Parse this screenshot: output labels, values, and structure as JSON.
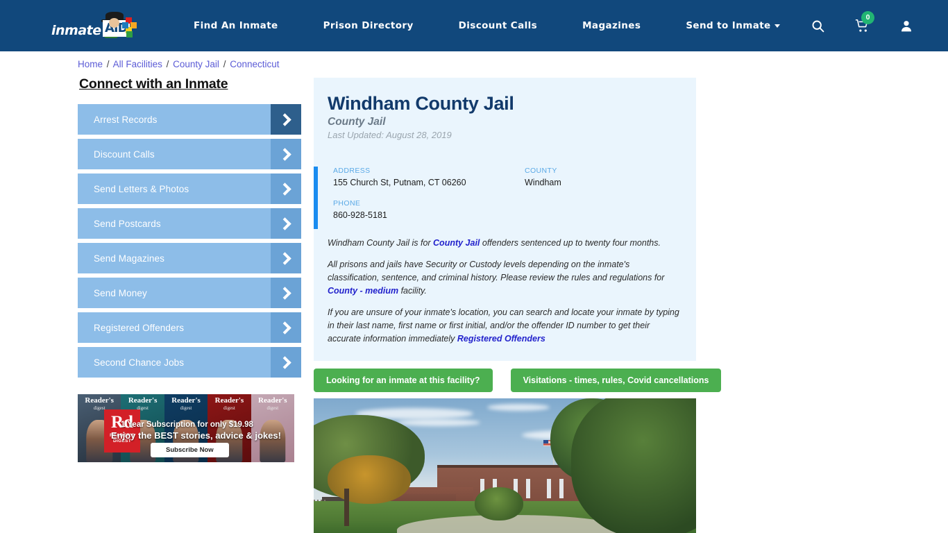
{
  "header": {
    "logo": {
      "word": "inmate",
      "aid": "AID",
      "alt": "inmateaid-logo"
    },
    "nav": [
      {
        "label": "Find An Inmate",
        "dropdown": false
      },
      {
        "label": "Prison Directory",
        "dropdown": false
      },
      {
        "label": "Discount Calls",
        "dropdown": false
      },
      {
        "label": "Magazines",
        "dropdown": false
      },
      {
        "label": "Send to Inmate",
        "dropdown": true
      }
    ],
    "icons": {
      "search": "search-icon",
      "cart": "shopping-cart-icon",
      "cart_count": "0",
      "account": "user-account-icon"
    },
    "colors": {
      "bar": "#11487c",
      "badge": "#22b573"
    }
  },
  "breadcrumb": {
    "items": [
      "Home",
      "All Facilities",
      "County Jail",
      "Connecticut"
    ],
    "separator": "/"
  },
  "sidebar": {
    "title": "Connect with an Inmate",
    "items": [
      {
        "label": "Arrest Records",
        "active": true
      },
      {
        "label": "Discount Calls",
        "active": false
      },
      {
        "label": "Send Letters & Photos",
        "active": false
      },
      {
        "label": "Send Postcards",
        "active": false
      },
      {
        "label": "Send Magazines",
        "active": false
      },
      {
        "label": "Send Money",
        "active": false
      },
      {
        "label": "Registered Offenders",
        "active": false
      },
      {
        "label": "Second Chance Jobs",
        "active": false
      }
    ]
  },
  "ad": {
    "brand": "Reader's",
    "brand2": "digest",
    "rd_mark": "Rd",
    "rd_label1": "READER'S",
    "rd_label2": "DIGEST",
    "line1": "1 Year Subscription for only $19.98",
    "line2": "Enjoy the BEST stories, advice & jokes!",
    "cta": "Subscribe Now"
  },
  "facility": {
    "title": "Windham County Jail",
    "subtitle": "County Jail",
    "last_updated": "Last Updated: August 28, 2019",
    "fields": {
      "address_label": "ADDRESS",
      "address_value": "155 Church St, Putnam, CT 06260",
      "phone_label": "PHONE",
      "phone_value": "860-928-5181",
      "county_label": "COUNTY",
      "county_value": "Windham"
    },
    "paragraphs": {
      "p1_a": "Windham County Jail is for ",
      "p1_link": "County Jail",
      "p1_b": " offenders sentenced up to twenty four months.",
      "p2_a": "All prisons and jails have Security or Custody levels depending on the inmate's classification, sentence, and criminal history. Please review the rules and regulations for ",
      "p2_link": "County - medium",
      "p2_b": " facility.",
      "p3_a": "If you are unsure of your inmate's location, you can search and locate your inmate by typing in their last name, first name or first initial, and/or the offender ID number to get their accurate information immediately ",
      "p3_link": "Registered Offenders"
    },
    "buttons": [
      {
        "label": "Looking for an inmate at this facility?"
      },
      {
        "label": "Visitations - times, rules, Covid cancellations"
      }
    ],
    "photo_alt": "windham-county-jail-exterior-photo"
  },
  "colors": {
    "header_navy": "#11487c",
    "panel_bg": "#eaf5fd",
    "accent_bar": "#1a8cf0",
    "sidebar_btn": "#8dbde8",
    "sidebar_arrow": "#6ba3d6",
    "sidebar_arrow_active": "#2e5f8c",
    "green_button": "#4caf50",
    "link_blue": "#2222cc",
    "title_navy": "#123a6b"
  }
}
